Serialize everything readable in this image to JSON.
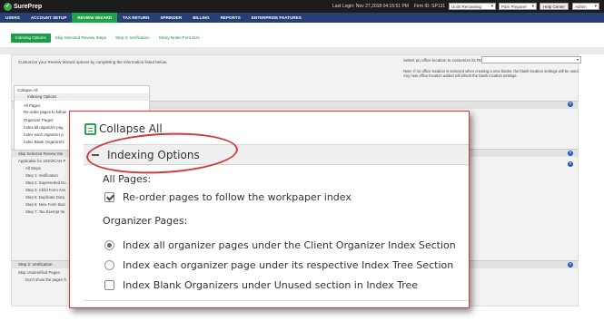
{
  "topbar": {
    "brand": "SurePrep",
    "last_login": "Last Login: Nov 27,2018 04:15:51 PM",
    "firm_id": "Firm ID: SP131",
    "units": "Units Remaining",
    "user": "Pam Preparer",
    "help": "Help Center",
    "admin": "Admin"
  },
  "nav": [
    "USERS",
    "ACCOUNT SETUP",
    "REVIEW WIZARD",
    "TAX RETURN",
    "SPRINDER",
    "BILLING",
    "REPORTS",
    "ENTERPRISE FEATURES"
  ],
  "subtabs": [
    "Indexing Options",
    "Skip Selected Review Steps",
    "Step 2: Verification",
    "Sticky Notes Font Size"
  ],
  "description": "Customize your Review Wizard options by completing the information listed below.",
  "office": {
    "label": "Select an office location to customize its Review Wizard options:",
    "note": "Note: If no office location is selected when creating a new binder, the blank location settings will be used. Any new office location added will inherit the blank location settings."
  },
  "mini": {
    "collapse": "Collapse All",
    "indexing": "Indexing Options",
    "all_pages": "All Pages:",
    "reorder": "Re-order pages to follow",
    "organizer": "Organizer Pages:",
    "o1": "Index all organizer pag",
    "o2": "Index each organizer p",
    "o3": "Index Blank Organizers"
  },
  "bg": {
    "skip_hdr": "Skip Selected Review Ste",
    "applicable": "Applicable for 1040/ICAN P",
    "steps": [
      "All Steps",
      "Step 1: Verification",
      "Step 2: Superseded Do",
      "Step 3: Child Form Ass",
      "Step 5: Duplicate Data",
      "Step 6: New Form Bod",
      "Step 7: Tax Exempt Ite"
    ],
    "verif_hdr": "Step 2: Verification",
    "unid": "Skip Unidentified Pages:",
    "dont": "Don't show the pages fr"
  },
  "zoom": {
    "collapse": "Collapse All",
    "indexing": "Indexing Options",
    "all_pages": "All Pages:",
    "reorder": "Re-order pages to follow the workpaper index",
    "organizer": "Organizer Pages:",
    "opt1": "Index all organizer pages under the Client Organizer Index Section",
    "opt2": "Index each organizer page under its respective Index Tree Section",
    "opt3": "Index Blank Organizers under Unused section in Index Tree"
  },
  "colors": {
    "nav_bg": "#263f74",
    "accent_green": "#1ea34b",
    "highlight_red": "#d23a3a"
  }
}
